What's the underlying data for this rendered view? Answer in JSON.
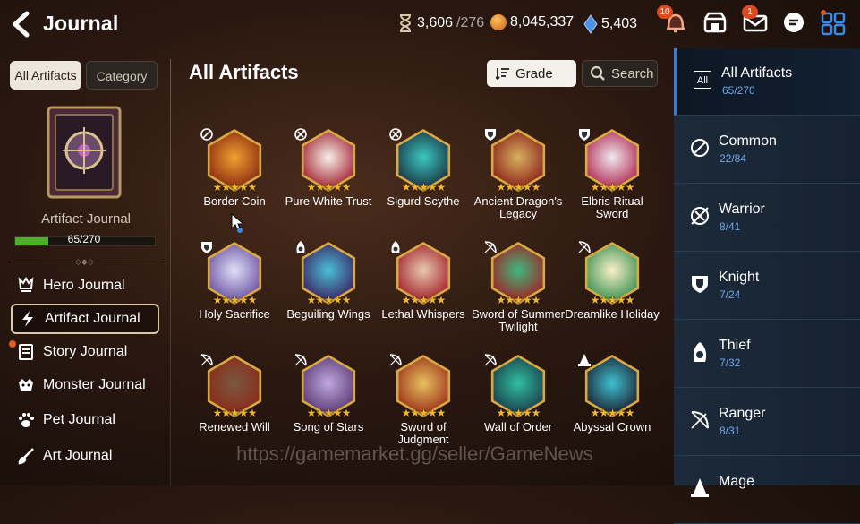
{
  "header": {
    "title": "Journal",
    "resources": [
      {
        "name": "stamina",
        "value": "3,606",
        "sub": "/276",
        "icon": "hourglass-icon",
        "color": "#d8c8a8"
      },
      {
        "name": "gold",
        "value": "8,045,337",
        "sub": "",
        "icon": "gold-coin-icon",
        "color": "#e8922a"
      },
      {
        "name": "skystone",
        "value": "5,403",
        "sub": "",
        "icon": "skystone-icon",
        "color": "#4a90e8"
      }
    ],
    "notification_badge": "10",
    "mail_badge": "1"
  },
  "sidebar": {
    "tabs": [
      {
        "label": "All Artifacts",
        "active": true
      },
      {
        "label": "Category",
        "active": false
      }
    ],
    "book_label": "Artifact Journal",
    "progress_text": "65/270",
    "progress_fraction": 0.24,
    "items": [
      {
        "label": "Hero Journal",
        "icon": "hero-icon",
        "active": false
      },
      {
        "label": "Artifact Journal",
        "icon": "lightning-icon",
        "active": true
      },
      {
        "label": "Story Journal",
        "icon": "story-book-icon",
        "active": false
      },
      {
        "label": "Monster Journal",
        "icon": "monster-icon",
        "active": false
      },
      {
        "label": "Pet Journal",
        "icon": "paw-icon",
        "active": false
      },
      {
        "label": "Art Journal",
        "icon": "brush-icon",
        "active": false
      }
    ]
  },
  "main": {
    "title": "All Artifacts",
    "grade_label": "Grade",
    "search_label": "Search",
    "artifacts": [
      {
        "name": "Border Coin",
        "class": "common",
        "c1": "#f0a030",
        "c2": "#8a2a10"
      },
      {
        "name": "Pure White Trust",
        "class": "warrior",
        "c1": "#f8f0e8",
        "c2": "#a02030"
      },
      {
        "name": "Sigurd Scythe",
        "class": "warrior",
        "c1": "#3ac8c0",
        "c2": "#1a3040"
      },
      {
        "name": "Ancient Dragon's Legacy",
        "class": "knight",
        "c1": "#d8b060",
        "c2": "#8a2018"
      },
      {
        "name": "Elbris Ritual Sword",
        "class": "knight",
        "c1": "#f0e8f0",
        "c2": "#b02850"
      },
      {
        "name": "Holy Sacrifice",
        "class": "knight",
        "c1": "#e0e0f8",
        "c2": "#6a50a0"
      },
      {
        "name": "Beguiling Wings",
        "class": "thief",
        "c1": "#4ac0d8",
        "c2": "#3a2060"
      },
      {
        "name": "Lethal Whispers",
        "class": "thief",
        "c1": "#e8c8b0",
        "c2": "#a02028"
      },
      {
        "name": "Sword of Summer Twilight",
        "class": "ranger",
        "c1": "#40b880",
        "c2": "#a02020"
      },
      {
        "name": "Dreamlike Holiday",
        "class": "ranger",
        "c1": "#f8f0c8",
        "c2": "#3a9050"
      },
      {
        "name": "Renewed Will",
        "class": "ranger",
        "c1": "#7a5840",
        "c2": "#8a2a18"
      },
      {
        "name": "Song of Stars",
        "class": "ranger",
        "c1": "#c0a8e0",
        "c2": "#5a3870"
      },
      {
        "name": "Sword of Judgment",
        "class": "ranger",
        "c1": "#e8c060",
        "c2": "#9a3018"
      },
      {
        "name": "Wall of Order",
        "class": "ranger",
        "c1": "#30c0a0",
        "c2": "#1a3a48"
      },
      {
        "name": "Abyssal Crown",
        "class": "mage",
        "c1": "#40c0d0",
        "c2": "#1a2030"
      }
    ],
    "star_text": "★★★★★",
    "watermark": "https://gamemarket.gg/seller/GameNews"
  },
  "categories": [
    {
      "name": "All Artifacts",
      "count": "65/270",
      "icon": "all-icon",
      "active": true
    },
    {
      "name": "Common",
      "count": "22/84",
      "icon": "common-icon",
      "active": false
    },
    {
      "name": "Warrior",
      "count": "8/41",
      "icon": "warrior-icon",
      "active": false
    },
    {
      "name": "Knight",
      "count": "7/24",
      "icon": "knight-shield-icon",
      "active": false
    },
    {
      "name": "Thief",
      "count": "7/32",
      "icon": "thief-hood-icon",
      "active": false
    },
    {
      "name": "Ranger",
      "count": "8/31",
      "icon": "ranger-bow-icon",
      "active": false
    },
    {
      "name": "Mage",
      "count": "",
      "icon": "mage-hat-icon",
      "active": false
    }
  ]
}
